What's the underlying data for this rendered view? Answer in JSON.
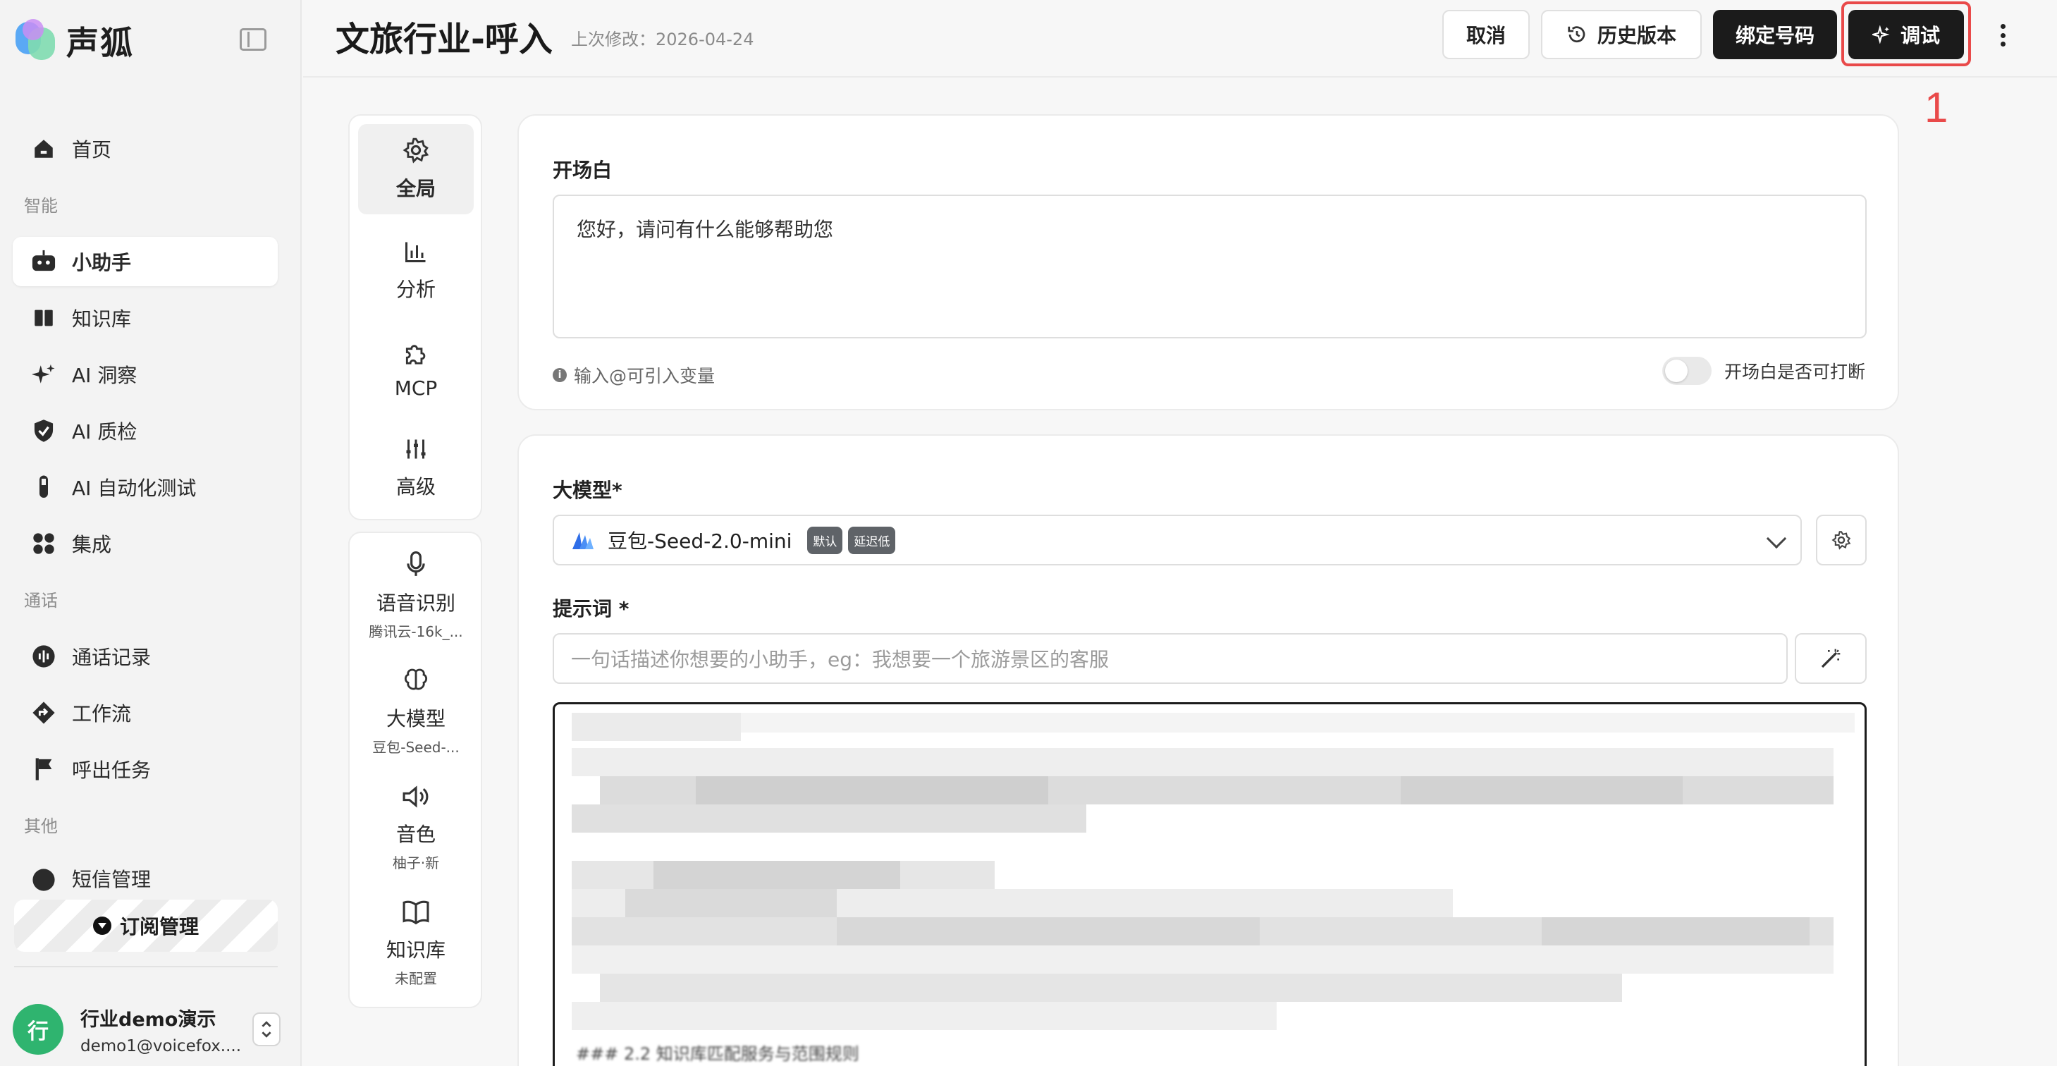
{
  "brand": {
    "name": "声狐"
  },
  "sidebar": {
    "items": [
      {
        "label": "首页",
        "icon": "home-icon"
      },
      {
        "label": "小助手",
        "icon": "robot-icon",
        "active": true
      },
      {
        "label": "知识库",
        "icon": "book-icon"
      },
      {
        "label": "AI 洞察",
        "icon": "sparkles-icon"
      },
      {
        "label": "AI 质检",
        "icon": "shield-check-icon"
      },
      {
        "label": "AI 自动化测试",
        "icon": "test-tube-icon"
      },
      {
        "label": "集成",
        "icon": "grid-dots-icon"
      },
      {
        "label": "通话记录",
        "icon": "audio-wave-icon"
      },
      {
        "label": "工作流",
        "icon": "workflow-icon"
      },
      {
        "label": "呼出任务",
        "icon": "flag-icon"
      },
      {
        "label": "短信管理",
        "icon": "message-icon"
      }
    ],
    "sections": [
      "智能",
      "通话",
      "其他"
    ],
    "subscribe_label": "订阅管理",
    "user": {
      "avatar": "行",
      "name": "行业demo演示",
      "email": "demo1@voicefox...."
    }
  },
  "header": {
    "title": "文旅行业-呼入",
    "modified": "上次修改：2026-04-24",
    "cancel_label": "取消",
    "history_label": "历史版本",
    "bind_label": "绑定号码",
    "debug_label": "调试",
    "annotation": "1"
  },
  "rail": {
    "top": [
      {
        "label": "全局",
        "icon": "gear-icon",
        "active": true
      },
      {
        "label": "分析",
        "icon": "bar-chart-icon"
      },
      {
        "label": "MCP",
        "icon": "puzzle-icon"
      },
      {
        "label": "高级",
        "icon": "sliders-icon"
      }
    ],
    "bottom": [
      {
        "label": "语音识别",
        "sub": "腾讯云-16k_...",
        "icon": "microphone-icon"
      },
      {
        "label": "大模型",
        "sub": "豆包-Seed-...",
        "icon": "brain-icon"
      },
      {
        "label": "音色",
        "sub": "柚子·新",
        "icon": "speaker-icon"
      },
      {
        "label": "知识库",
        "sub": "未配置",
        "icon": "book-open-icon"
      }
    ]
  },
  "opening": {
    "label": "开场白",
    "value": "您好，请问有什么能够帮助您",
    "hint": "输入@可引入变量",
    "toggle_label": "开场白是否可打断",
    "toggle_on": false
  },
  "model": {
    "label": "大模型*",
    "selected": "豆包-Seed-2.0-mini",
    "badges": [
      "默认",
      "延迟低"
    ],
    "prompt_label": "提示词 *",
    "prompt_placeholder": "一句话描述你想要的小助手，eg：我想要一个旅游景区的客服",
    "prompt_tail": "### 2.2 知识库匹配服务与范围规则"
  },
  "colors": {
    "accent_dark": "#1b1b1b",
    "annotation_red": "#e94a4a",
    "avatar_green": "#2fb46f"
  }
}
